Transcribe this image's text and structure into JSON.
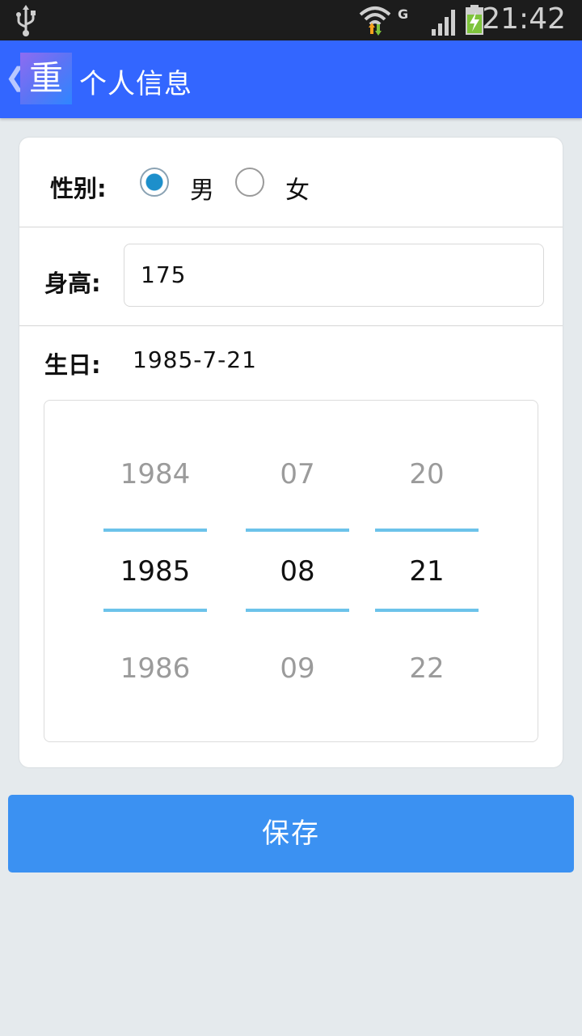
{
  "status_bar": {
    "time": "21:42",
    "network_type": "G",
    "icons": [
      "usb-icon",
      "wifi-icon",
      "signal-icon",
      "battery-charging-icon"
    ]
  },
  "app_bar": {
    "back_glyph": "❮",
    "logo_char": "重",
    "title": "个人信息"
  },
  "form": {
    "gender": {
      "label": "性别:",
      "options": [
        {
          "label": "男",
          "checked": true
        },
        {
          "label": "女",
          "checked": false
        }
      ]
    },
    "height": {
      "label": "身高:",
      "value": "175"
    },
    "birthday": {
      "label": "生日:",
      "value": "1985-7-21",
      "picker": {
        "year": {
          "prev": "1984",
          "selected": "1985",
          "next": "1986"
        },
        "month": {
          "prev": "07",
          "selected": "08",
          "next": "09"
        },
        "day": {
          "prev": "20",
          "selected": "21",
          "next": "22"
        }
      }
    }
  },
  "actions": {
    "save_label": "保存"
  },
  "colors": {
    "app_bar": "#3366ff",
    "save_button": "#3b91f2",
    "picker_highlight": "#6cc3ea",
    "background": "#e5eaed"
  }
}
